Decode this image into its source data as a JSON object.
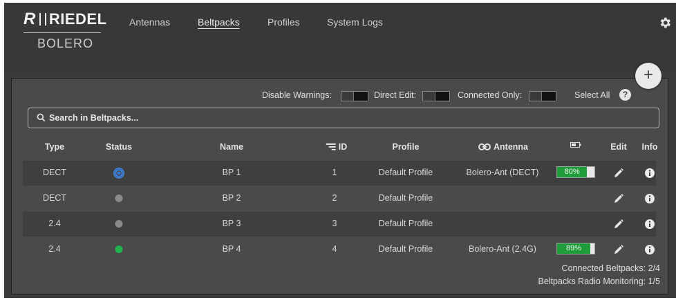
{
  "brand": {
    "logo_glyph": "R",
    "logo_text": "RIEDEL",
    "product": "BOLERO"
  },
  "nav": [
    {
      "label": "Antennas",
      "active": false
    },
    {
      "label": "Beltpacks",
      "active": true
    },
    {
      "label": "Profiles",
      "active": false
    },
    {
      "label": "System Logs",
      "active": false
    }
  ],
  "add_button": "+",
  "options": {
    "disable_warnings": "Disable Warnings:",
    "direct_edit": "Direct Edit:",
    "connected_only": "Connected Only:",
    "select_all": "Select All",
    "help": "?"
  },
  "search": {
    "placeholder": "Search in Beltpacks...",
    "value": ""
  },
  "columns": {
    "type": "Type",
    "status": "Status",
    "name": "Name",
    "id": "ID",
    "profile": "Profile",
    "antenna": "Antenna",
    "edit": "Edit",
    "info": "Info"
  },
  "rows": [
    {
      "type": "DECT",
      "status": "radio",
      "name": "BP 1",
      "id": "1",
      "profile": "Default Profile",
      "antenna": "Bolero-Ant (DECT)",
      "battery": "80%",
      "battery_level": 0.8
    },
    {
      "type": "DECT",
      "status": "offline",
      "name": "BP 2",
      "id": "2",
      "profile": "Default Profile",
      "antenna": "",
      "battery": "",
      "battery_level": null
    },
    {
      "type": "2.4",
      "status": "offline",
      "name": "BP 3",
      "id": "3",
      "profile": "Default Profile",
      "antenna": "",
      "battery": "",
      "battery_level": null
    },
    {
      "type": "2.4",
      "status": "online",
      "name": "BP 4",
      "id": "4",
      "profile": "Default Profile",
      "antenna": "Bolero-Ant (2.4G)",
      "battery": "89%",
      "battery_level": 0.89
    }
  ],
  "footer": {
    "connected": "Connected Beltpacks: 2/4",
    "radio_monitoring": "Beltpacks Radio Monitoring: 1/5"
  },
  "colors": {
    "online": "#22b14c",
    "offline": "#8a8a8a",
    "radio": "#3d7fd6",
    "battery": "#1f9d3a"
  }
}
